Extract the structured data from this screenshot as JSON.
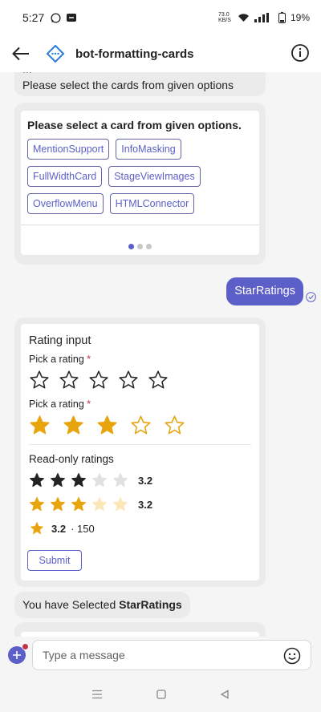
{
  "status_bar": {
    "time": "5:27",
    "net_speed": "73.0 KB/S",
    "battery": "19%"
  },
  "header": {
    "title": "bot-formatting-cards"
  },
  "chat": {
    "intro_line1": "...",
    "intro_line2": "Please select the cards from given options",
    "card": {
      "title": "Please select a card from given options.",
      "options": [
        "MentionSupport",
        "InfoMasking",
        "FullWidthCard",
        "StageViewImages",
        "OverflowMenu",
        "HTMLConnector"
      ]
    },
    "sent_message": "StarRatings",
    "rating_card": {
      "heading": "Rating input",
      "pick_label_1": "Pick a rating",
      "pick_label_2": "Pick a rating",
      "required_mark": "*",
      "input_rating_1": 0,
      "input_rating_2": 3,
      "readonly_heading": "Read-only ratings",
      "readonly_1_value": "3.2",
      "readonly_2_value": "3.2",
      "compact_value": "3.2",
      "compact_count": "· 150",
      "submit_label": "Submit"
    },
    "selected_prefix": "You have Selected",
    "selected_value": "StarRatings"
  },
  "composer": {
    "placeholder": "Type a message"
  },
  "colors": {
    "accent": "#5b5fc7",
    "star_gold": "#e8a40c",
    "star_dark": "#242424"
  }
}
